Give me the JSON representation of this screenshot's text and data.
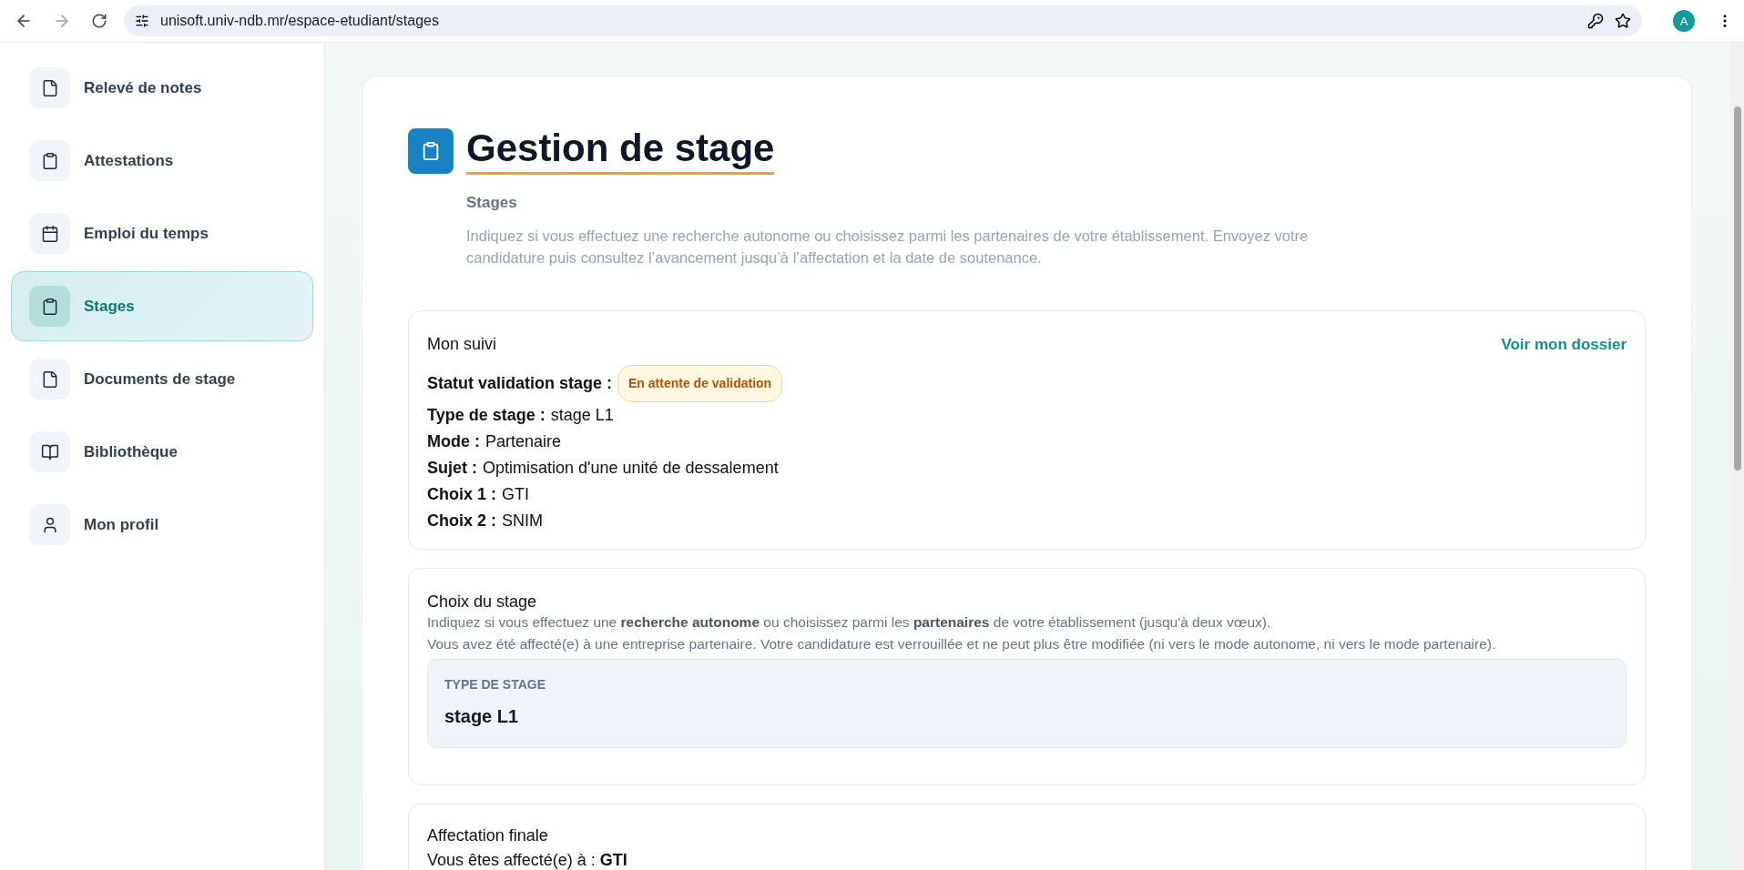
{
  "browser": {
    "url": "unisoft.univ-ndb.mr/espace-etudiant/stages",
    "avatar": "A"
  },
  "sidebar": {
    "items": [
      {
        "label": "Relevé de notes",
        "kind": "file",
        "selected": false
      },
      {
        "label": "Attestations",
        "kind": "clipboard",
        "selected": false
      },
      {
        "label": "Emploi du temps",
        "kind": "calendar",
        "selected": false
      },
      {
        "label": "Stages",
        "kind": "clipboard",
        "selected": true
      },
      {
        "label": "Documents de stage",
        "kind": "file",
        "selected": false
      },
      {
        "label": "Bibliothèque",
        "kind": "book",
        "selected": false
      },
      {
        "label": "Mon profil",
        "kind": "user",
        "selected": false
      }
    ]
  },
  "header": {
    "title": "Gestion de stage",
    "subtitle": "Stages",
    "description": "Indiquez si vous effectuez une recherche autonome ou choisissez parmi les partenaires de votre établissement. Envoyez votre candidature puis consultez l’avancement jusqu’à l’affectation et la date de soutenance."
  },
  "suivi": {
    "title": "Mon suivi",
    "link": "Voir mon dossier",
    "status": {
      "label": "Statut validation stage :",
      "badge": "En attente de validation"
    },
    "fields": [
      {
        "label": "Type de stage :",
        "value": "stage L1"
      },
      {
        "label": "Mode :",
        "value": "Partenaire"
      },
      {
        "label": "Sujet :",
        "value": "Optimisation d'une unité de dessalement"
      },
      {
        "label": "Choix 1 :",
        "value": "GTI"
      },
      {
        "label": "Choix 2 :",
        "value": "SNIM"
      }
    ]
  },
  "choix": {
    "title": "Choix du stage",
    "notes": [
      "Indiquez si vous effectuez une **recherche autonome** ou choisissez parmi les **partenaires** de votre établissement (jusqu'à deux vœux).",
      "Vous avez été affecté(e) à une entreprise partenaire. Votre candidature est verrouillée et ne peut plus être modifiée (ni vers le mode autonome, ni vers le mode partenaire)."
    ],
    "field": {
      "label": "TYPE DE STAGE",
      "value": "stage L1"
    }
  },
  "affectation": {
    "title": "Affectation finale",
    "text": "Vous êtes affecté(e) à : **GTI**"
  }
}
